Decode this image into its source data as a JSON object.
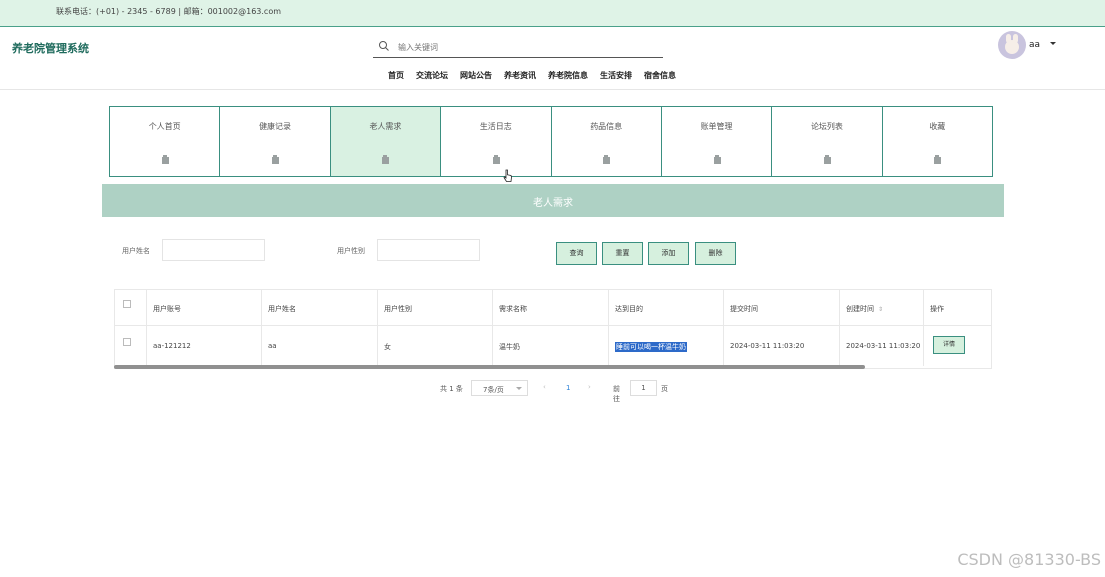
{
  "topbar": {
    "contact": "联系电话：(+01) - 2345 - 6789 | 邮箱：001002@163.com"
  },
  "header": {
    "brand": "养老院管理系统",
    "search_placeholder": "输入关键词",
    "nav": [
      "首页",
      "交流论坛",
      "网站公告",
      "养老资讯",
      "养老院信息",
      "生活安排",
      "宿舍信息"
    ],
    "username": "aa"
  },
  "tabs": [
    {
      "label": "个人首页",
      "active": false
    },
    {
      "label": "健康记录",
      "active": false
    },
    {
      "label": "老人需求",
      "active": true
    },
    {
      "label": "生活日志",
      "active": false
    },
    {
      "label": "药品信息",
      "active": false
    },
    {
      "label": "账单管理",
      "active": false
    },
    {
      "label": "论坛列表",
      "active": false
    },
    {
      "label": "收藏",
      "active": false
    }
  ],
  "banner": {
    "title": "老人需求"
  },
  "filters": {
    "name_label": "用户姓名",
    "gender_label": "用户性别"
  },
  "buttons": {
    "query": "查询",
    "reset": "重置",
    "add": "添加",
    "delete": "删除"
  },
  "table": {
    "headers": [
      "用户账号",
      "用户姓名",
      "用户性别",
      "需求名称",
      "达到目的",
      "提交时间",
      "创建时间",
      "操作"
    ],
    "rows": [
      [
        "aa-121212",
        "aa",
        "女",
        "温牛奶",
        "睡前可以喝一杯温牛奶",
        "2024-03-11 11:03:20",
        "2024-03-11 11:03:20",
        "详情"
      ]
    ]
  },
  "pager": {
    "total": "共 1 条",
    "size": "7条/页",
    "page": "1",
    "goto": "前往",
    "goto_value": "1",
    "page_suffix": "页"
  },
  "watermark": "CSDN @81330-BS"
}
